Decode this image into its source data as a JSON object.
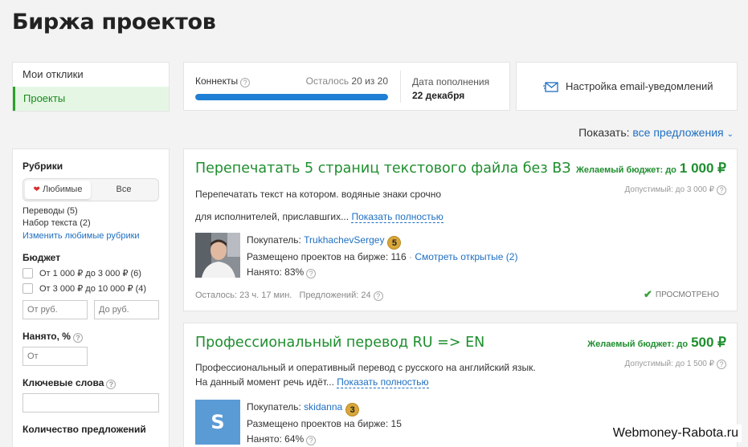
{
  "page": {
    "title": "Биржа проектов"
  },
  "nav": {
    "items": [
      "Мои отклики",
      "Проекты"
    ],
    "active_index": 1
  },
  "connects": {
    "label": "Конннекты",
    "remaining_label": "Осталось",
    "remaining_value": "20 из 20",
    "progress_fraction": 1.0,
    "topup_label": "Дата пополнения",
    "topup_date": "22 декабря"
  },
  "email": {
    "label": "Настройка email-уведомлений"
  },
  "show": {
    "label": "Показать:",
    "value": "все предложения"
  },
  "filters": {
    "rubrics_title": "Рубрики",
    "tab_favorites": "Любимые",
    "tab_all": "Все",
    "rubric_1": "Переводы (5)",
    "rubric_2": "Набор текста (2)",
    "change_link": "Изменить любимые рубрики",
    "budget_title": "Бюджет",
    "budget_opt_1": "От 1 000 ₽ до 3 000 ₽ (6)",
    "budget_opt_2": "От 3 000 ₽ до 10 000 ₽ (4)",
    "from_placeholder": "От руб.",
    "to_placeholder": "До руб.",
    "hired_title": "Нанято, %",
    "hired_placeholder": "От",
    "keywords_title": "Ключевые слова",
    "offers_title": "Количество предложений"
  },
  "projects": [
    {
      "title": "Перепечатать 5 страниц текстового файла без ВЗ",
      "budget_label": "Желаемый бюджет: до",
      "budget_amount": "1 000 ₽",
      "allowed": "Допустимый: до 3 000 ₽",
      "desc_line1": "Перепечатать текст на котором. водяные знаки срочно",
      "desc_line2": "для исполнителей, приславшгих...",
      "show_more": "Показать полностью",
      "buyer_label": "Покупатель:",
      "buyer_name": "TrukhachevSergey",
      "buyer_level": "5",
      "placed": "Размещено проектов на бирже: 116",
      "sep": "·",
      "open_link": "Смотреть открытые (2)",
      "hired": "Нанято: 83%",
      "time_left": "Осталось: 23 ч. 17 мин.",
      "offers": "Предложений: 24",
      "status": "ПРОСМОТРЕНО"
    },
    {
      "title": "Профессиональный перевод RU => EN",
      "budget_label": "Желаемый бюджет: до",
      "budget_amount": "500 ₽",
      "allowed": "Допустимый: до 1 500 ₽",
      "desc_line1": "Профессиональный и оперативный перевод с русского на английский язык.",
      "desc_line2": "На данный момент речь идёт...",
      "show_more": "Показать полностью",
      "buyer_label": "Покупатель:",
      "buyer_name": "skidanna",
      "buyer_level": "3",
      "avatar_letter": "S",
      "placed": "Размещено проектов на бирже: 15",
      "hired": "Нанято: 64%"
    }
  ],
  "watermark": "Webmoney-Rabota.ru",
  "colors": {
    "accent_green": "#1e8e2e",
    "link_blue": "#1e6fc2",
    "progress_blue": "#1e7fd4"
  }
}
